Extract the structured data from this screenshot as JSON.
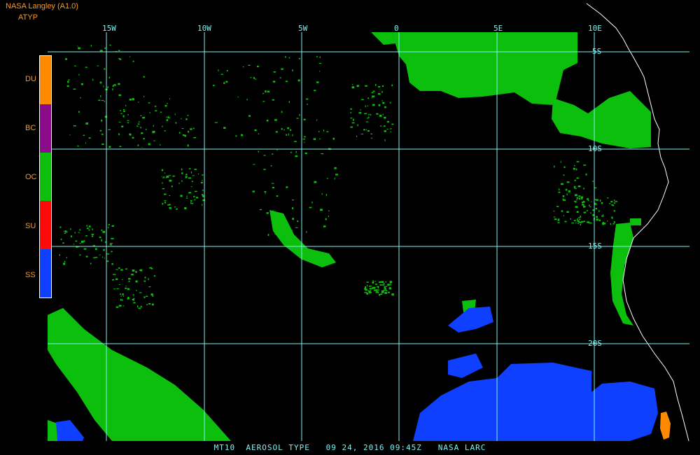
{
  "header": {
    "title": "NASA Langley (A1.0)",
    "subtitle": "ATYP"
  },
  "legend": {
    "items": [
      {
        "code": "DU",
        "color": "#ff8a00"
      },
      {
        "code": "BC",
        "color": "#8a0a8a"
      },
      {
        "code": "OC",
        "color": "#0dbf0d"
      },
      {
        "code": "SU",
        "color": "#ff0a0a"
      },
      {
        "code": "SS",
        "color": "#1040ff"
      }
    ]
  },
  "grid": {
    "longitudes": [
      "15W",
      "10W",
      "5W",
      "0",
      "5E",
      "10E"
    ],
    "latitudes": [
      "5S",
      "10S",
      "15S",
      "20S"
    ]
  },
  "footer": {
    "text": "MT10  AEROSOL TYPE   09 24, 2016 09:45Z   NASA LARC"
  },
  "colors": {
    "grid": "#7ff0f0",
    "coast": "#ffffff",
    "background": "#000000"
  }
}
